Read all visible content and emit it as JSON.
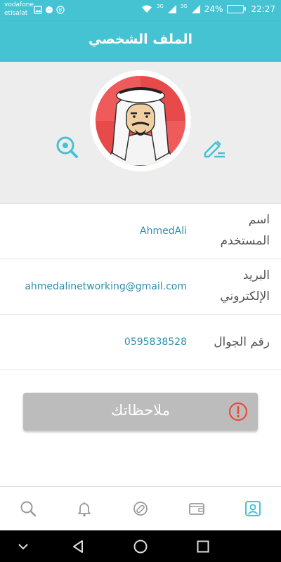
{
  "status_bar": {
    "carrier_1": "vodafone",
    "carrier_2": "etisalat",
    "network_1": "3G",
    "network_2": "3G",
    "battery": "24%",
    "time": "22:27"
  },
  "header": {
    "title": "الملف الشخصي"
  },
  "profile": {
    "fields": [
      {
        "label": "اسم المستخدم",
        "value": "AhmedAli"
      },
      {
        "label": "البريد الإلكتروني",
        "value": "ahmedalinetworking@gmail.com"
      },
      {
        "label": "رقم الجوال",
        "value": "0595838528"
      }
    ]
  },
  "notes_button": {
    "label": "ملاحظاتك"
  },
  "tabs": [
    {
      "icon": "search-icon"
    },
    {
      "icon": "bell-icon"
    },
    {
      "icon": "pills-icon"
    },
    {
      "icon": "wallet-icon"
    },
    {
      "icon": "profile-icon",
      "active": true
    }
  ],
  "colors": {
    "primary": "#45c3d3",
    "value_text": "#2f8ea8",
    "alert": "#e74c3c",
    "button_gray": "#bcbcbc"
  }
}
